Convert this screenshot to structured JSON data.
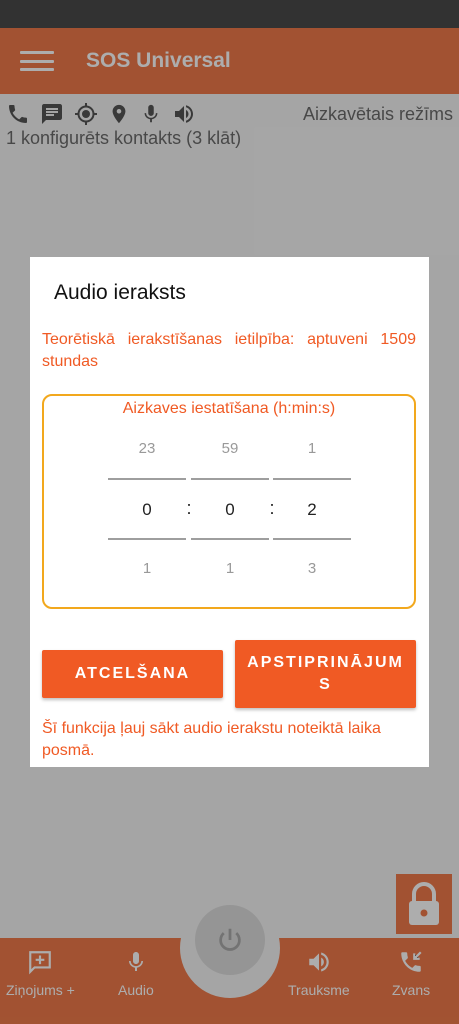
{
  "app": {
    "title": "SOS Universal"
  },
  "status": {
    "mode": "Aizkavētais režīms",
    "contacts": "1 konfigurēts kontakts (3 klāt)"
  },
  "icons": [
    "phone-icon",
    "message-icon",
    "gps-icon",
    "location-pin-icon",
    "microphone-icon",
    "speaker-icon"
  ],
  "dialog": {
    "title": "Audio ieraksts",
    "capacity": "Teorētiskā ierakstīšanas ietilpība: aptuveni 1509 stundas",
    "picker_title": "Aizkaves iestatīšana (h:min:s)",
    "hours": {
      "prev": "23",
      "value": "0",
      "next": "1"
    },
    "minutes": {
      "prev": "59",
      "value": "0",
      "next": "1"
    },
    "seconds": {
      "prev": "1",
      "value": "2",
      "next": "3"
    },
    "separator": ":",
    "cancel_label": "ATCELŠANA",
    "confirm_label": "APSTIPRINĀJUMS",
    "info": "Šī funkcija ļauj sākt audio ierakstu noteiktā laika posmā."
  },
  "bottom_nav": {
    "messages": "Ziņojums +",
    "audio": "Audio",
    "alarm": "Trauksme",
    "call": "Zvans"
  },
  "colors": {
    "accent": "#f05a24",
    "appbar": "#ef7a4a",
    "picker_border": "#f2a81d"
  }
}
